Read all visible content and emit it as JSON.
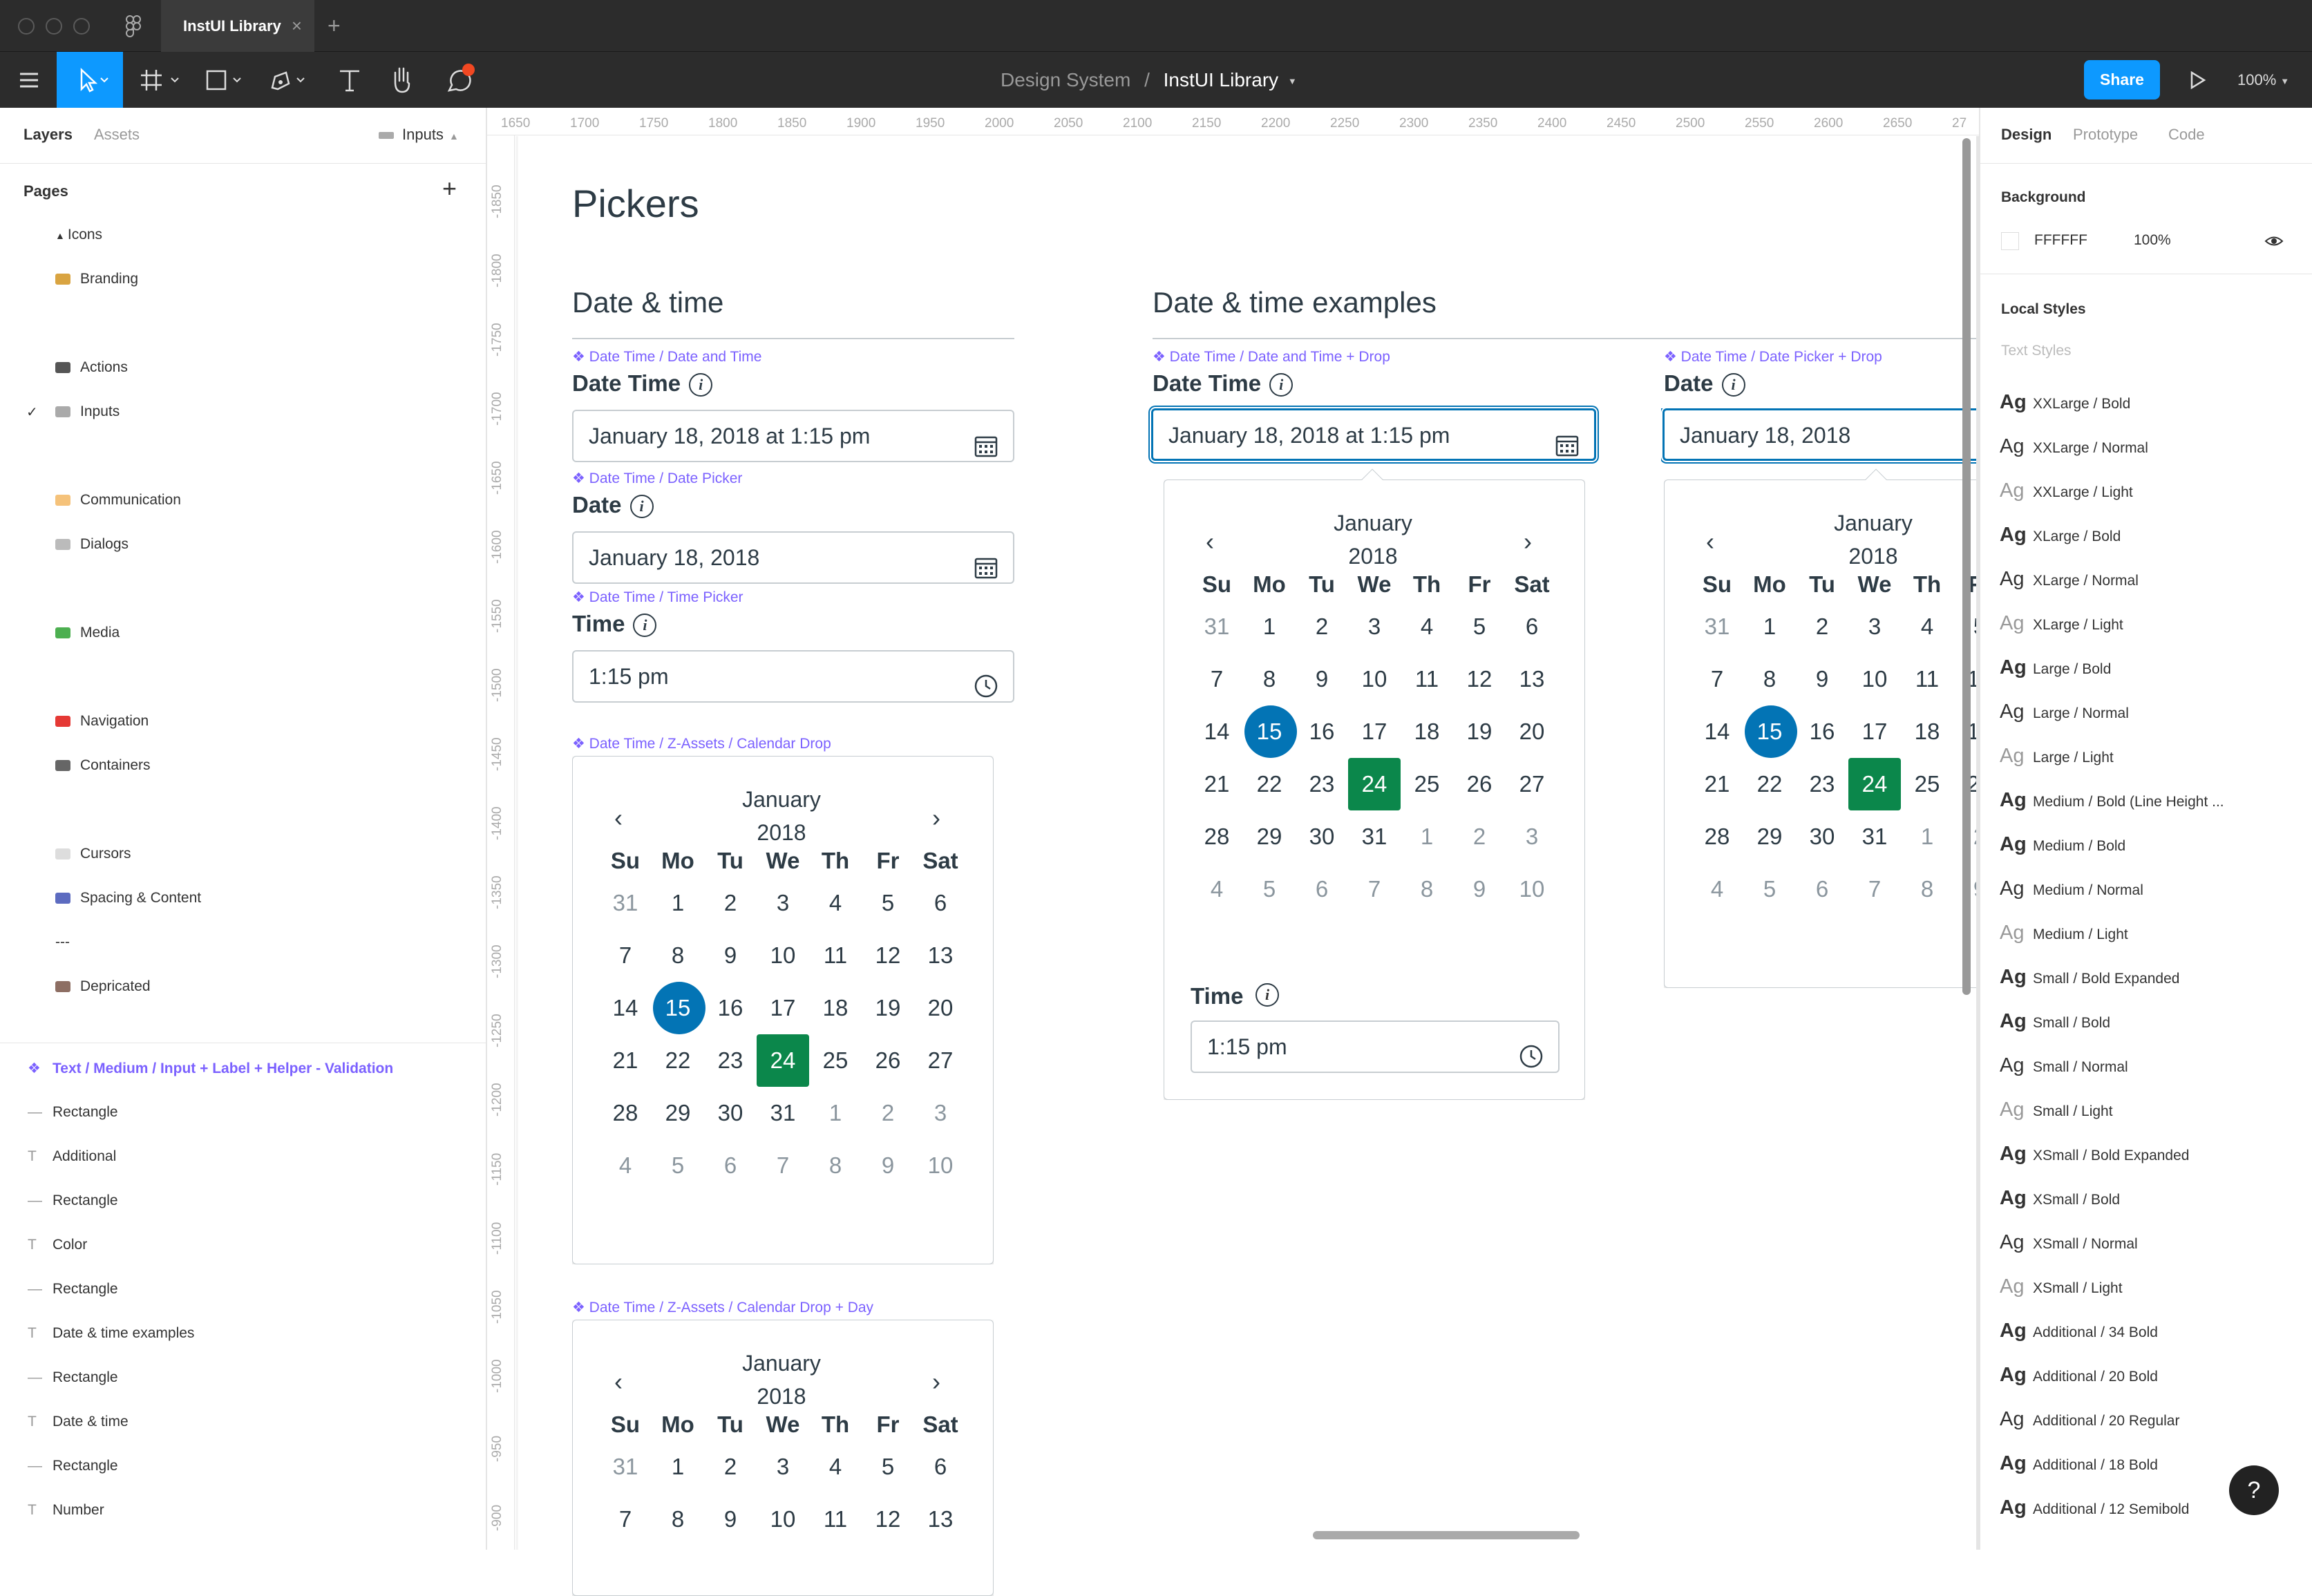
{
  "app": {
    "tab_title": "InstUI Library",
    "breadcrumb_project": "Design System",
    "breadcrumb_sep": "/",
    "breadcrumb_file": "InstUI Library",
    "share_label": "Share",
    "zoom": "100%"
  },
  "left_panel": {
    "tabs": [
      "Layers",
      "Assets"
    ],
    "page_selector": "Inputs",
    "pages_title": "Pages",
    "pages": [
      {
        "label": "Icons",
        "icon": "triangle-icon"
      },
      {
        "label": "Branding",
        "icon": "palette-icon",
        "color": "#d9a441"
      },
      {
        "label": "Actions",
        "icon": "grid-icon",
        "color": "#555"
      },
      {
        "label": "Inputs",
        "icon": "input-icon",
        "color": "#aaa",
        "checked": true
      },
      {
        "label": "Communication",
        "icon": "bubble-icon",
        "color": "#f5c27a"
      },
      {
        "label": "Dialogs",
        "icon": "speech-icon",
        "color": "#bbb"
      },
      {
        "label": "Media",
        "icon": "image-icon",
        "color": "#4caf50"
      },
      {
        "label": "Navigation",
        "icon": "pin-icon",
        "color": "#e53935"
      },
      {
        "label": "Containers",
        "icon": "box-icon",
        "color": "#666"
      },
      {
        "label": "Cursors",
        "icon": "cursor-icon",
        "color": "#ddd"
      },
      {
        "label": "Spacing & Content",
        "icon": "ruler-icon",
        "color": "#5c6bc0"
      },
      {
        "label": "---",
        "icon": "",
        "color": ""
      },
      {
        "label": "Depricated",
        "icon": "house-icon",
        "color": "#8d6e63"
      }
    ],
    "layers": [
      {
        "label": "Text / Medium / Input + Label + Helper - Validation",
        "type": "component"
      },
      {
        "label": "Rectangle",
        "type": "rect"
      },
      {
        "label": "Additional",
        "type": "text"
      },
      {
        "label": "Rectangle",
        "type": "rect"
      },
      {
        "label": "Color",
        "type": "text"
      },
      {
        "label": "Rectangle",
        "type": "rect"
      },
      {
        "label": "Date & time examples",
        "type": "text"
      },
      {
        "label": "Rectangle",
        "type": "rect"
      },
      {
        "label": "Date & time",
        "type": "text"
      },
      {
        "label": "Rectangle",
        "type": "rect"
      },
      {
        "label": "Number",
        "type": "text"
      }
    ]
  },
  "rulers": {
    "top": [
      "1650",
      "1700",
      "1750",
      "1800",
      "1850",
      "1900",
      "1950",
      "2000",
      "2050",
      "2100",
      "2150",
      "2200",
      "2250",
      "2300",
      "2350",
      "2400",
      "2450",
      "2500",
      "2550",
      "2600",
      "2650",
      "27"
    ],
    "left": [
      "-1850",
      "-1800",
      "-1750",
      "-1700",
      "-1650",
      "-1600",
      "-1550",
      "-1500",
      "-1450",
      "-1400",
      "-1350",
      "-1300",
      "-1250",
      "-1200",
      "-1150",
      "-1100",
      "-1050",
      "-1000",
      "-950",
      "-900"
    ]
  },
  "canvas": {
    "page_title": "Pickers",
    "section_left": "Date & time",
    "section_right": "Date & time examples",
    "comp_datetime": "❖ Date Time / Date and Time",
    "comp_datepicker": "❖ Date Time / Date Picker",
    "comp_timepicker": "❖ Date Time / Time Picker",
    "comp_caldrop": "❖ Date Time / Z-Assets / Calendar Drop",
    "comp_caldrop_day": "❖ Date Time / Z-Assets / Calendar Drop + Day",
    "comp_datetime_drop": "❖ Date Time / Date and Time + Drop",
    "comp_datepicker_drop": "❖ Date Time / Date Picker + Drop",
    "label_datetime": "Date Time",
    "label_date": "Date",
    "label_time": "Time",
    "value_datetime": "January 18, 2018 at 1:15 pm",
    "value_date": "January 18, 2018",
    "value_time": "1:15 pm",
    "info_glyph": "i",
    "calendar": {
      "month": "January",
      "year": "2018",
      "weekdays": [
        "Su",
        "Mo",
        "Tu",
        "We",
        "Th",
        "Fr",
        "Sat"
      ],
      "weeks": [
        [
          "31",
          "1",
          "2",
          "3",
          "4",
          "5",
          "6"
        ],
        [
          "7",
          "8",
          "9",
          "10",
          "11",
          "12",
          "13"
        ],
        [
          "14",
          "15",
          "16",
          "17",
          "18",
          "19",
          "20"
        ],
        [
          "21",
          "22",
          "23",
          "24",
          "25",
          "26",
          "27"
        ],
        [
          "28",
          "29",
          "30",
          "31",
          "1",
          "2",
          "3"
        ],
        [
          "4",
          "5",
          "6",
          "7",
          "8",
          "9",
          "10"
        ]
      ],
      "selected": "15",
      "today": "24",
      "selected_color": "#0374b5",
      "today_color": "#0b874b"
    }
  },
  "right_panel": {
    "tabs": [
      "Design",
      "Prototype",
      "Code"
    ],
    "background_title": "Background",
    "bg_hex": "FFFFFF",
    "bg_opacity": "100%",
    "local_styles_title": "Local Styles",
    "text_styles_title": "Text Styles",
    "ag": "Ag",
    "text_styles": [
      {
        "label": "XXLarge / Bold",
        "w": "b"
      },
      {
        "label": "XXLarge / Normal",
        "w": "n"
      },
      {
        "label": "XXLarge / Light",
        "w": "l"
      },
      {
        "label": "XLarge / Bold",
        "w": "b"
      },
      {
        "label": "XLarge / Normal",
        "w": "n"
      },
      {
        "label": "XLarge / Light",
        "w": "l"
      },
      {
        "label": "Large / Bold",
        "w": "b"
      },
      {
        "label": "Large / Normal",
        "w": "n"
      },
      {
        "label": "Large / Light",
        "w": "l"
      },
      {
        "label": "Medium / Bold (Line Height ...",
        "w": "b"
      },
      {
        "label": "Medium / Bold",
        "w": "b"
      },
      {
        "label": "Medium / Normal",
        "w": "n"
      },
      {
        "label": "Medium / Light",
        "w": "l"
      },
      {
        "label": "Small / Bold Expanded",
        "w": "b"
      },
      {
        "label": "Small / Bold",
        "w": "b"
      },
      {
        "label": "Small / Normal",
        "w": "n"
      },
      {
        "label": "Small / Light",
        "w": "l"
      },
      {
        "label": "XSmall / Bold Expanded",
        "w": "b"
      },
      {
        "label": "XSmall / Bold",
        "w": "b"
      },
      {
        "label": "XSmall / Normal",
        "w": "n"
      },
      {
        "label": "XSmall / Light",
        "w": "l"
      },
      {
        "label": "Additional / 34 Bold",
        "w": "b"
      },
      {
        "label": "Additional / 20 Bold",
        "w": "b"
      },
      {
        "label": "Additional / 20 Regular",
        "w": "n"
      },
      {
        "label": "Additional / 18 Bold",
        "w": "b"
      },
      {
        "label": "Additional / 12 Semibold",
        "w": "b"
      }
    ],
    "help": "?"
  }
}
